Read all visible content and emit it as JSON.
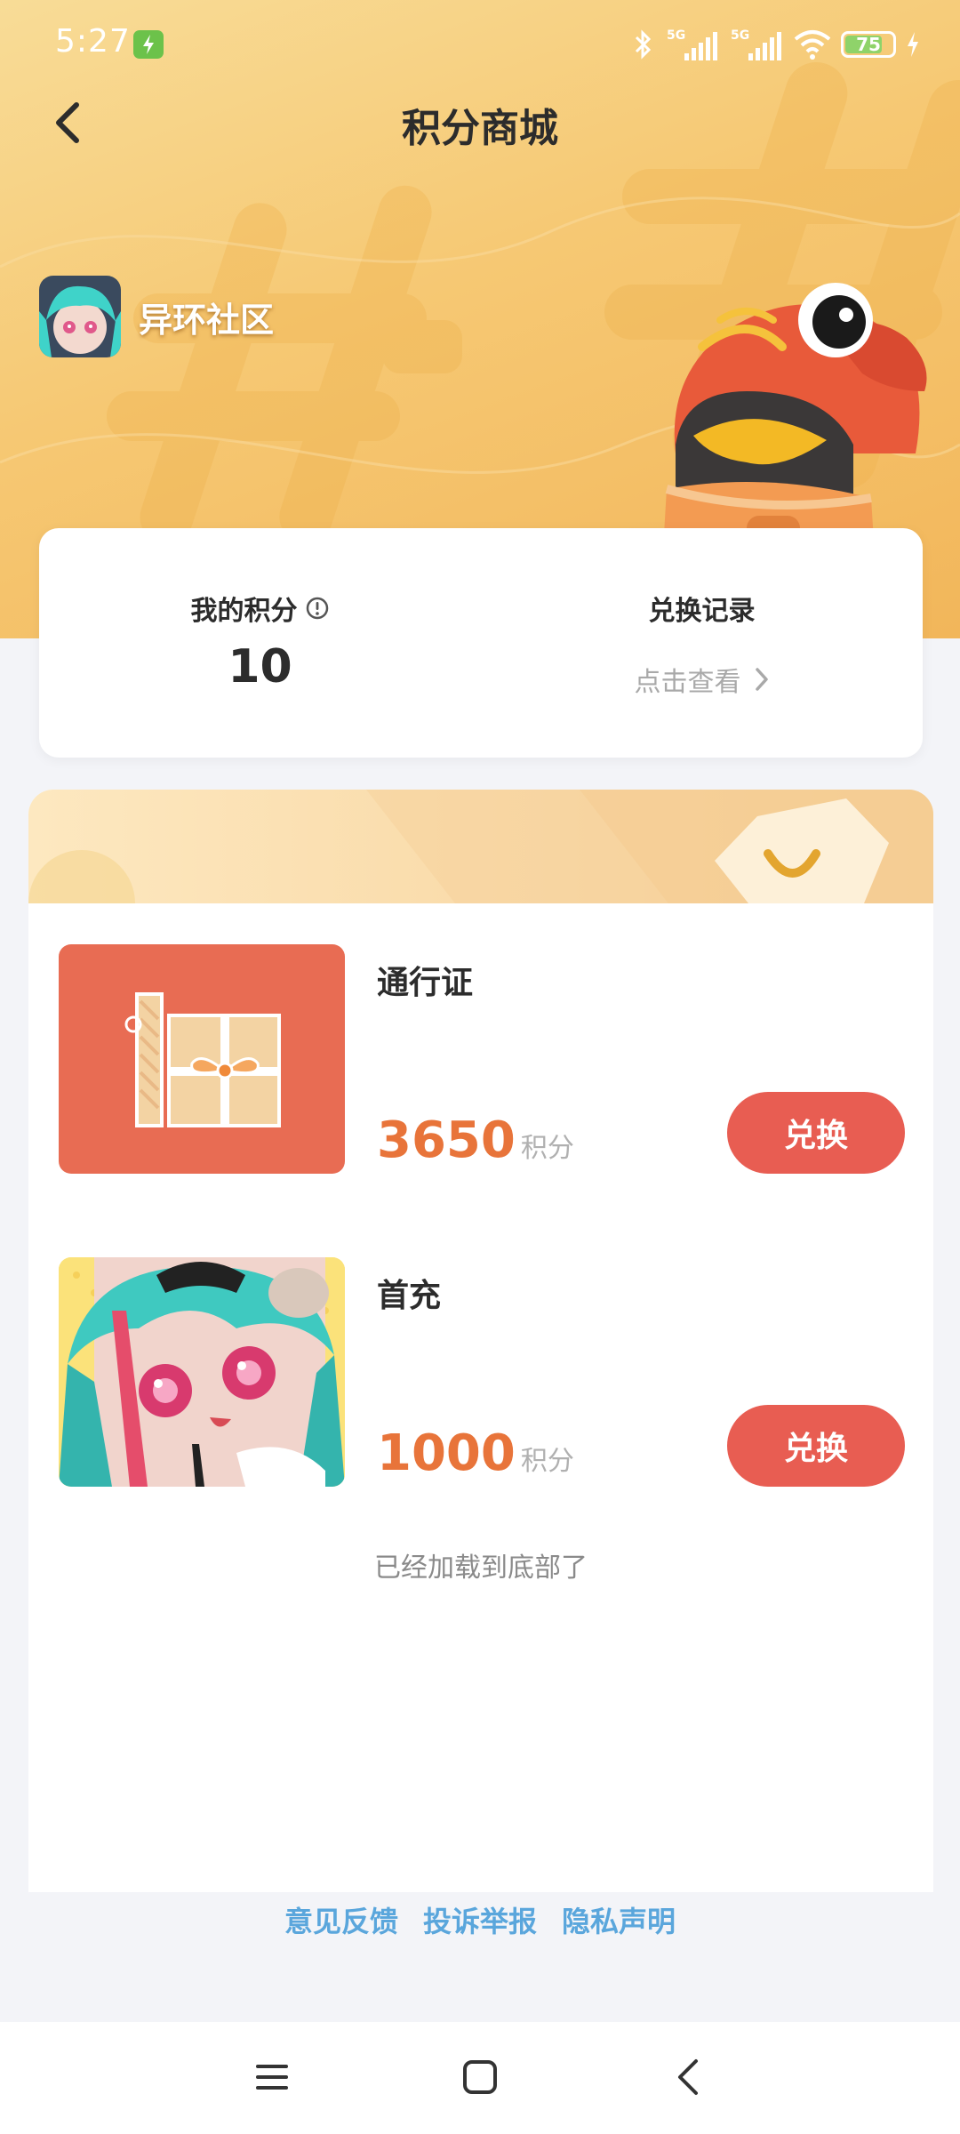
{
  "status_bar": {
    "time": "5:27",
    "battery_level": "75",
    "icons": [
      "bluetooth-icon",
      "signal-5g-icon",
      "signal-5g-icon",
      "wifi-icon",
      "battery-icon",
      "charging-icon"
    ]
  },
  "header": {
    "title": "积分商城",
    "back_icon": "chevron-left-icon"
  },
  "community": {
    "name": "异环社区"
  },
  "points_card": {
    "my_points_label": "我的积分",
    "my_points_value": "10",
    "records_label": "兑换记录",
    "records_link": "点击查看"
  },
  "products": [
    {
      "name": "通行证",
      "price": "3650",
      "unit": "积分",
      "button": "兑换",
      "thumb": "gift-box-image"
    },
    {
      "name": "首充",
      "price": "1000",
      "unit": "积分",
      "button": "兑换",
      "thumb": "anime-character-image"
    }
  ],
  "list_end_text": "已经加载到底部了",
  "footer": {
    "links": [
      "意见反馈",
      "投诉举报",
      "隐私声明"
    ]
  },
  "nav": {
    "icons": [
      "menu-icon",
      "home-icon",
      "back-icon"
    ]
  },
  "colors": {
    "accent_orange": "#e8743a",
    "redeem_red": "#e85d52",
    "link_blue": "#5aa6dc",
    "hero_yellow": "#f6c873"
  }
}
